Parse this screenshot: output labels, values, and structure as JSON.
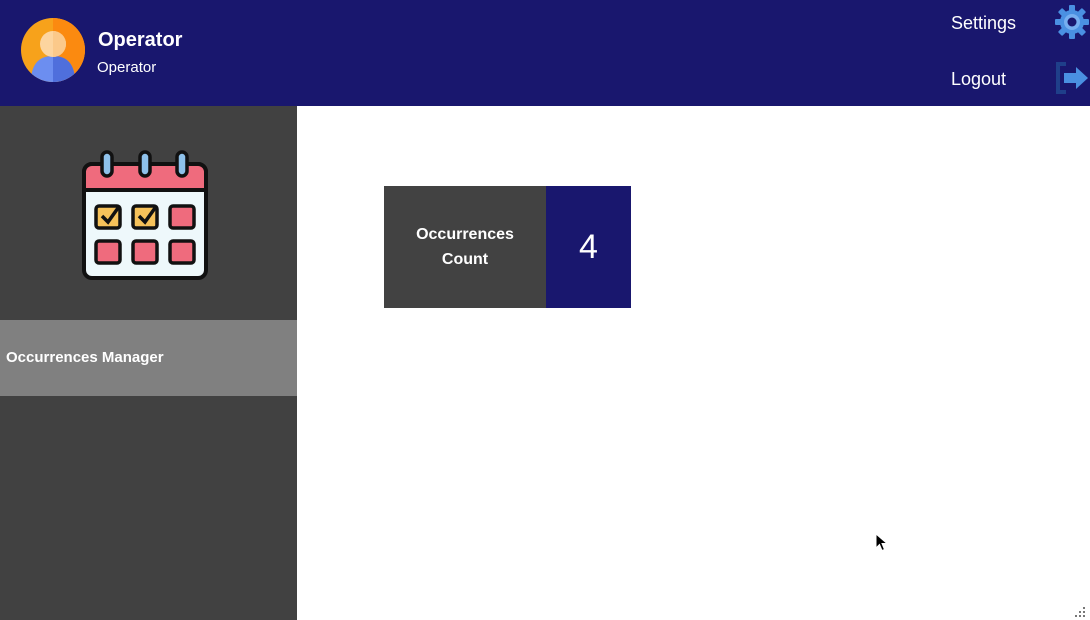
{
  "header": {
    "user_name": "Operator",
    "user_role": "Operator",
    "settings_label": "Settings",
    "logout_label": "Logout",
    "avatar_icon": "user-avatar-icon",
    "settings_icon": "gear-icon",
    "logout_icon": "logout-icon",
    "colors": {
      "header_bg": "#19176e",
      "icon_blue": "#4a90e2"
    }
  },
  "sidebar": {
    "logo_icon": "calendar-icon",
    "items": [
      {
        "label": "Occurrences Manager",
        "selected": true
      }
    ],
    "colors": {
      "bg": "#414141",
      "selected_bg": "#808080"
    }
  },
  "main": {
    "count_card": {
      "label": "Occurrences Count",
      "value": "4",
      "colors": {
        "label_bg": "#424242",
        "value_bg": "#19176e"
      }
    }
  }
}
